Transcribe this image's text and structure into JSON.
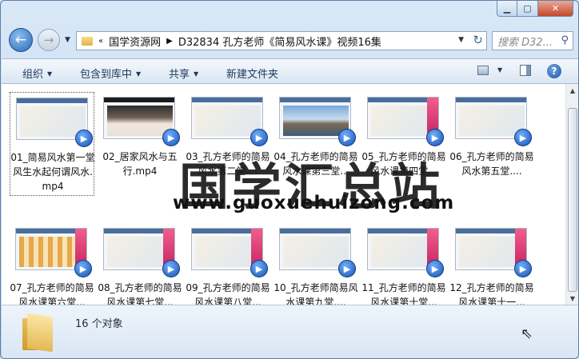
{
  "window": {
    "buttons": {
      "minimize": "▁",
      "maximize": "▢",
      "close": "✕"
    }
  },
  "nav": {
    "back_icon": "←",
    "forward_icon": "→",
    "dropdown": "▼",
    "address": {
      "overflow": "«",
      "crumbs": [
        "国学资源网",
        "D32834 孔方老师《简易风水课》视频16集"
      ],
      "separator": "▶",
      "dropdown": "▼",
      "refresh": "↻"
    },
    "search_placeholder": "搜索 D32...",
    "search_icon": "⚲"
  },
  "toolbar": {
    "organize": "组织",
    "include_in_library": "包含到库中",
    "share": "共享",
    "new_folder": "新建文件夹",
    "dropdown_arrow": "▼",
    "help": "?"
  },
  "files": [
    {
      "name": "01_简易风水第一堂风生水起何谓风水.mp4",
      "thumb": "desktop",
      "selected": true
    },
    {
      "name": "02_居家风水与五行.mp4",
      "thumb": "photo"
    },
    {
      "name": "03_孔方老师的简易风水第二堂....",
      "thumb": "desktop"
    },
    {
      "name": "04_孔方老师的简易风水课第三堂...",
      "thumb": "scene"
    },
    {
      "name": "05_孔方老师的简易风水课第四堂...",
      "thumb": "slides"
    },
    {
      "name": "06_孔方老师的简易风水第五堂....",
      "thumb": "desktop"
    },
    {
      "name": "07_孔方老师的简易风水课第六堂...",
      "thumb": "grid-sheet"
    },
    {
      "name": "08_孔方老师的简易风水课第七堂...",
      "thumb": "slides"
    },
    {
      "name": "09_孔方老师的简易风水课第八堂...",
      "thumb": "slides"
    },
    {
      "name": "10_孔方老师简易风水课第九堂....",
      "thumb": "desktop"
    },
    {
      "name": "11_孔方老师的简易风水课第十堂...",
      "thumb": "slides"
    },
    {
      "name": "12_孔方老师的简易风水课第十一...",
      "thumb": "slides"
    }
  ],
  "media_badge_icon": "▶",
  "watermark": {
    "text": "国学汇总站",
    "url": "www.guoxuehuizong.com"
  },
  "status": {
    "count_text": "16 个对象"
  },
  "scroll": {
    "up": "▲",
    "down": "▼"
  }
}
